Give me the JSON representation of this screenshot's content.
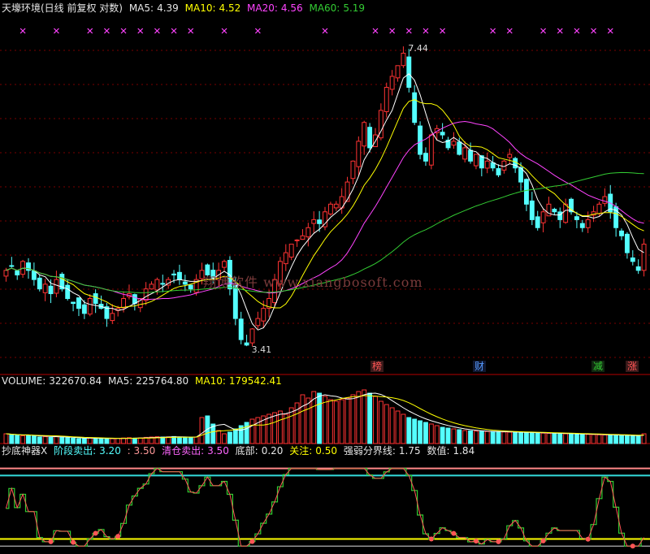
{
  "header": {
    "title": "天壕环境(日线 前复权 对数)",
    "ma5_label": "MA5:",
    "ma5_value": "4.39",
    "ma10_label": "MA10:",
    "ma10_value": "4.52",
    "ma20_label": "MA20:",
    "ma20_value": "4.56",
    "ma60_label": "MA60:",
    "ma60_value": "5.19"
  },
  "volume_header": {
    "volume_label": "VOLUME:",
    "volume_value": "322670.84",
    "ma5_label": "MA5:",
    "ma5_value": "225764.80",
    "ma10_label": "MA10:",
    "ma10_value": "179542.41"
  },
  "indicator_header": {
    "name": "抄底神器X",
    "stage_sell_label": "阶段卖出:",
    "stage_sell_value": "3.20",
    "stage_sell_value2": ": 3.50",
    "clear_sell_label": "清仓卖出:",
    "clear_sell_value": "3.50",
    "bottom_label": "底部:",
    "bottom_value": "0.20",
    "attention_label": "关注:",
    "attention_value": "0.50",
    "divide_label": "强弱分界线:",
    "divide_value": "1.75",
    "value_label": "数值:",
    "value_value": "1.84"
  },
  "price_annotations": {
    "high": "7.44",
    "low": "3.41"
  },
  "tags": [
    {
      "text": "榜",
      "color": "#ff5555",
      "bg": "#3a1a1a"
    },
    {
      "text": "财",
      "color": "#5599ff",
      "bg": "#101830"
    },
    {
      "text": "减",
      "color": "#33cc33",
      "bg": "#102810"
    },
    {
      "text": "涨",
      "color": "#ff5555",
      "bg": "#3a1a1a"
    }
  ],
  "watermark": "翔博软件 www.xiangbosoft.com",
  "colors": {
    "up": "#ff3333",
    "down": "#54ffff",
    "ma5": "#ffffff",
    "ma10": "#ffff00",
    "ma20": "#ff44ff",
    "ma60": "#33cc33",
    "grid": "#7a0000",
    "cross": "#ff44ff"
  },
  "chart_data": {
    "type": "candlestick",
    "price_panel": {
      "scale": "log",
      "ylim": [
        3.2,
        8.2
      ],
      "max_label": 7.44,
      "min_label": 3.41
    },
    "candles_ohlc_pattern": "derived",
    "close_series": [
      4.2,
      4.25,
      4.15,
      4.3,
      4.2,
      4.1,
      4.0,
      4.05,
      3.95,
      4.1,
      4.0,
      3.9,
      3.85,
      3.8,
      3.75,
      3.9,
      3.85,
      3.8,
      3.7,
      3.75,
      3.8,
      3.9,
      3.95,
      3.85,
      3.9,
      4.0,
      4.05,
      4.1,
      4.05,
      4.1,
      4.15,
      4.1,
      4.05,
      4.0,
      4.1,
      4.2,
      4.15,
      4.1,
      4.2,
      4.3,
      4.0,
      3.7,
      3.5,
      3.45,
      3.6,
      3.7,
      3.8,
      3.9,
      4.1,
      4.3,
      4.4,
      4.5,
      4.55,
      4.6,
      4.7,
      4.8,
      4.75,
      4.9,
      5.0,
      5.0,
      5.1,
      5.3,
      5.6,
      5.9,
      6.2,
      5.8,
      6.0,
      6.4,
      6.8,
      7.0,
      7.2,
      7.44,
      6.8,
      6.2,
      5.7,
      5.6,
      6.0,
      6.1,
      6.0,
      5.8,
      5.9,
      5.7,
      5.8,
      5.6,
      5.7,
      5.5,
      5.6,
      5.5,
      5.4,
      5.6,
      5.7,
      5.5,
      5.3,
      5.0,
      4.8,
      4.7,
      4.9,
      5.0,
      4.9,
      4.8,
      5.0,
      4.9,
      4.8,
      4.7,
      4.8,
      4.9,
      5.0,
      5.1,
      4.9,
      4.7,
      4.6,
      4.4,
      4.3,
      4.2,
      4.5
    ],
    "ma_lines": [
      "MA5",
      "MA10",
      "MA20",
      "MA60"
    ],
    "volume_panel": {
      "values": [
        60,
        55,
        50,
        48,
        52,
        45,
        40,
        42,
        38,
        44,
        40,
        35,
        33,
        30,
        32,
        36,
        34,
        30,
        28,
        30,
        32,
        34,
        36,
        33,
        35,
        38,
        40,
        42,
        40,
        41,
        43,
        40,
        38,
        36,
        40,
        160,
        170,
        120,
        80,
        60,
        70,
        90,
        110,
        130,
        150,
        160,
        170,
        180,
        190,
        200,
        180,
        220,
        250,
        300,
        280,
        320,
        310,
        290,
        270,
        260,
        270,
        280,
        300,
        320,
        330,
        310,
        290,
        260,
        240,
        220,
        200,
        180,
        160,
        150,
        140,
        130,
        120,
        110,
        100,
        95,
        90,
        85,
        80,
        78,
        76,
        75,
        74,
        73,
        72,
        71,
        70,
        69,
        68,
        67,
        66,
        65,
        64,
        63,
        62,
        61,
        60,
        59,
        58,
        57,
        56,
        55,
        54,
        53,
        52,
        51,
        50,
        49,
        48,
        47,
        60
      ],
      "ylim": [
        0,
        340
      ]
    },
    "indicator_panel": {
      "upper_lines": [
        3.5,
        3.2
      ],
      "lower_lines": [
        0.5,
        0.2
      ],
      "ylim": [
        0,
        3.8
      ]
    }
  }
}
